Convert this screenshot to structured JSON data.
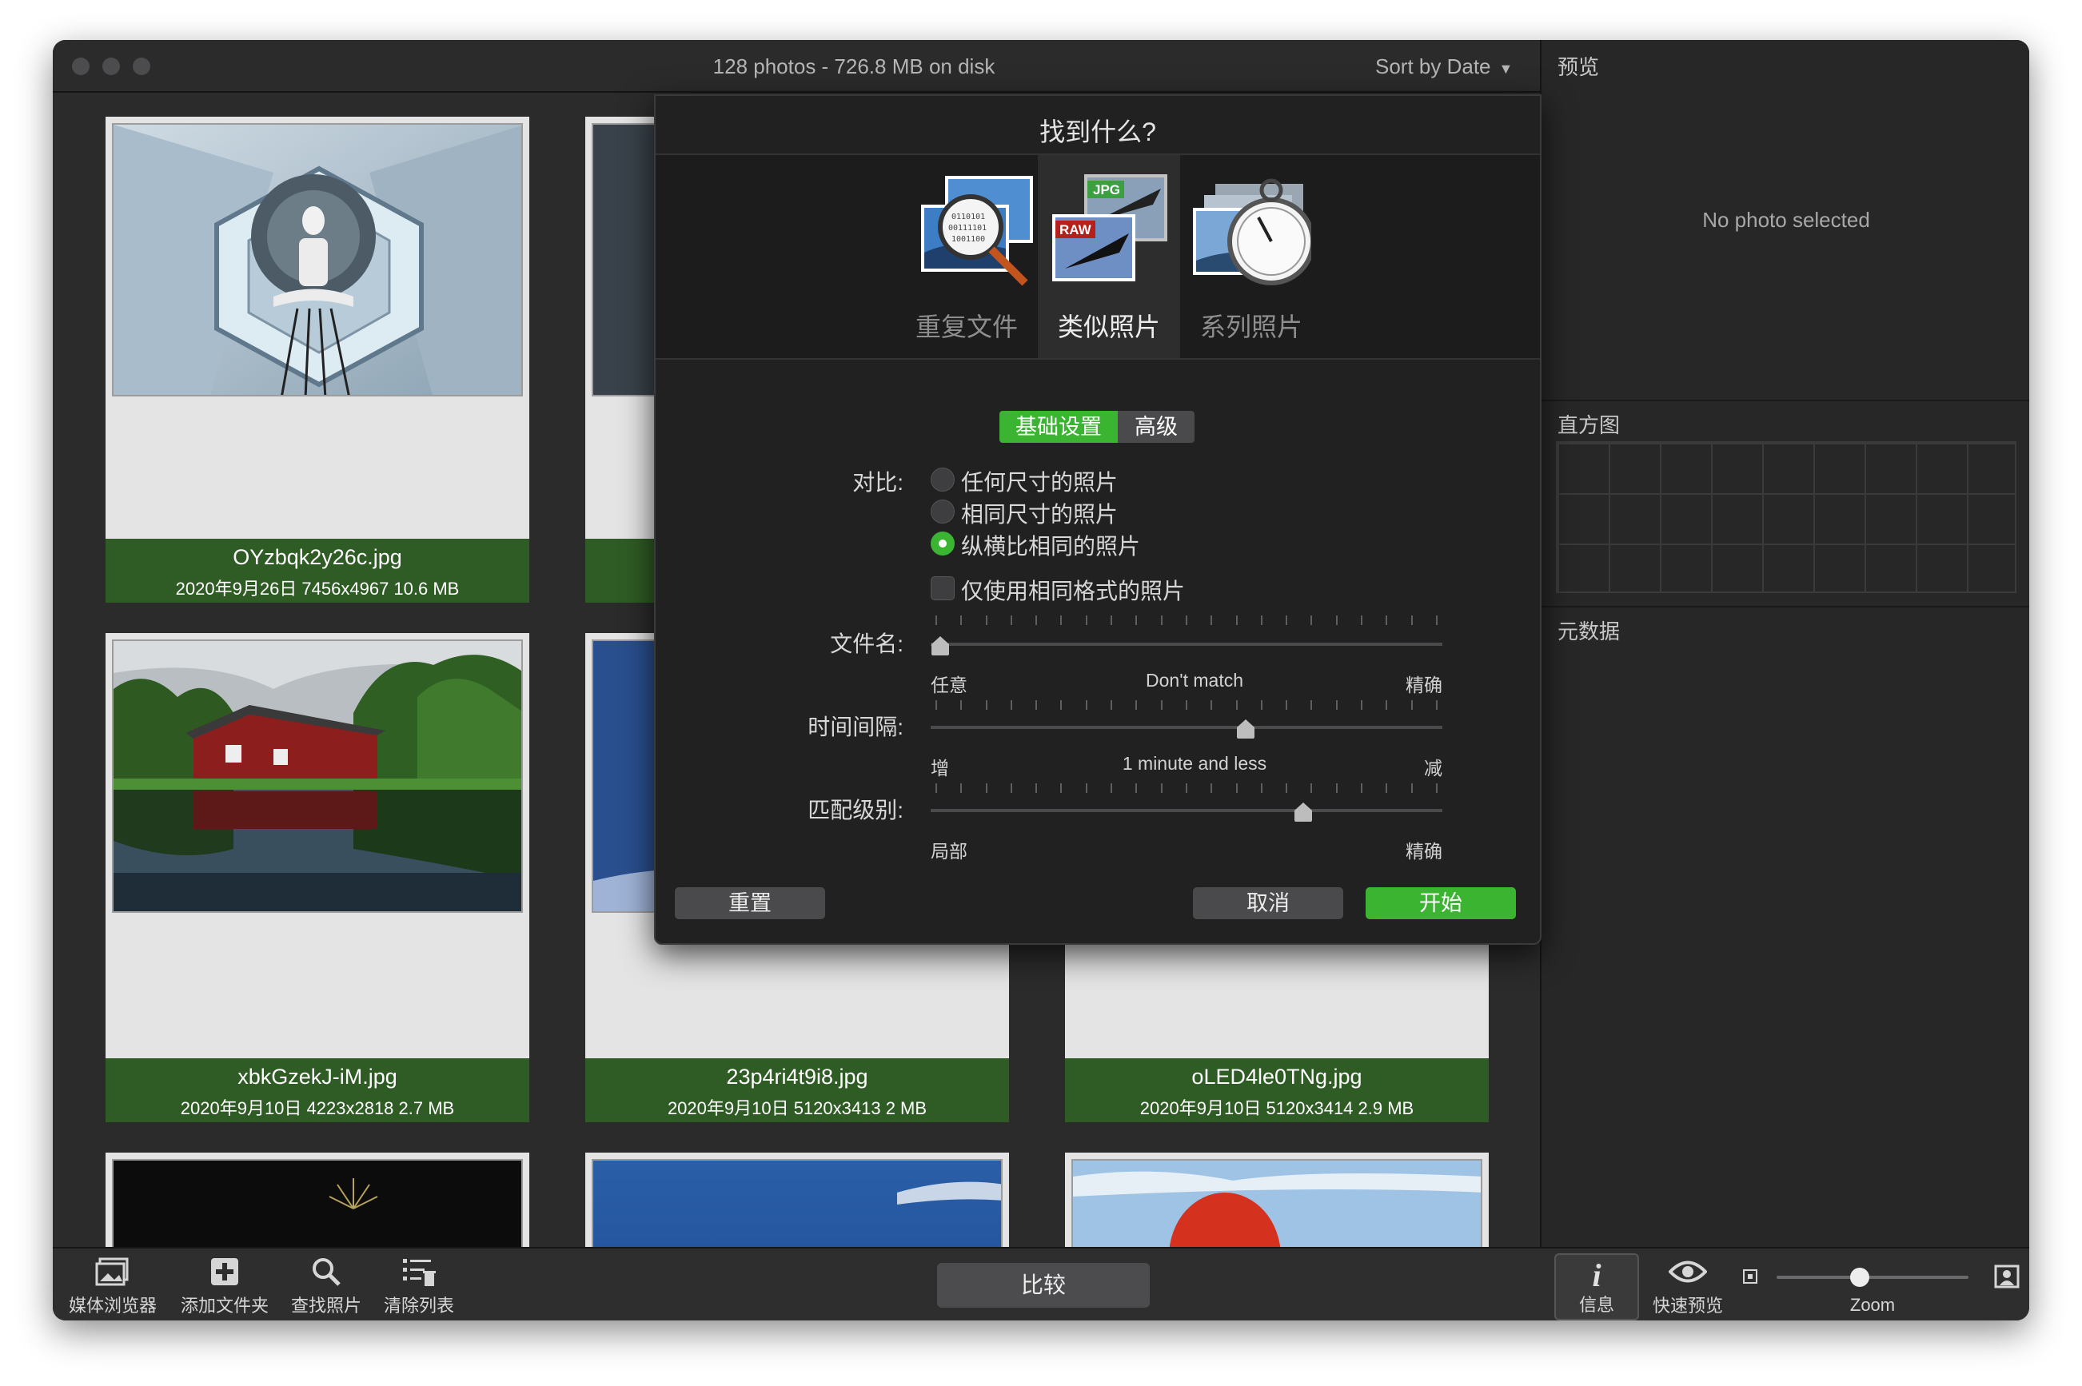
{
  "window": {
    "title": "128 photos - 726.8 MB on disk",
    "sort_label": "Sort by Date"
  },
  "cards": [
    {
      "name": "OYzbqk2y26c.jpg",
      "meta": "2020年9月26日  7456x4967  10.6 MB"
    },
    {
      "name": "xbkGzekJ-iM.jpg",
      "meta": "2020年9月10日  4223x2818  2.7 MB"
    },
    {
      "name": "23p4ri4t9i8.jpg",
      "meta": "2020年9月10日  5120x3413  2 MB"
    },
    {
      "name": "oLED4le0TNg.jpg",
      "meta": "2020年9月10日  5120x3414  2.9 MB"
    }
  ],
  "right_panel": {
    "preview_title": "预览",
    "no_photo": "No photo selected",
    "histogram_title": "直方图",
    "metadata_title": "元数据"
  },
  "toolbar": {
    "media_browser": "媒体浏览器",
    "add_folder": "添加文件夹",
    "find_photos": "查找照片",
    "clear_list": "清除列表",
    "compare": "比较",
    "info": "信息",
    "quick_look": "快速预览",
    "zoom": "Zoom",
    "zoom_level": 0.62
  },
  "dialog": {
    "title": "找到什么?",
    "modes": [
      {
        "label": "重复文件",
        "selected": false
      },
      {
        "label": "类似照片",
        "selected": true
      },
      {
        "label": "系列照片",
        "selected": false
      }
    ],
    "mode_badges": {
      "jpg": "JPG",
      "raw": "RAW"
    },
    "tabs": {
      "basic": "基础设置",
      "advanced": "高级",
      "active": "basic"
    },
    "compare_label": "对比:",
    "options": [
      {
        "label": "任何尺寸的照片",
        "checked": false
      },
      {
        "label": "相同尺寸的照片",
        "checked": false
      },
      {
        "label": "纵横比相同的照片",
        "checked": true
      }
    ],
    "same_format": {
      "label": "仅使用相同格式的照片",
      "checked": false
    },
    "filename": {
      "label": "文件名:",
      "min": "任意",
      "value": "Don't match",
      "max": "精确",
      "position": 0.0
    },
    "interval": {
      "label": "时间间隔:",
      "min": "增",
      "value": "1 minute and less",
      "max": "减",
      "position": 0.6
    },
    "match": {
      "label": "匹配级别:",
      "min": "局部",
      "max": "精确",
      "position": 0.72
    },
    "buttons": {
      "reset": "重置",
      "cancel": "取消",
      "start": "开始"
    },
    "colors": {
      "accent": "#3bb432",
      "selected_row": "#2d2d2e"
    }
  }
}
